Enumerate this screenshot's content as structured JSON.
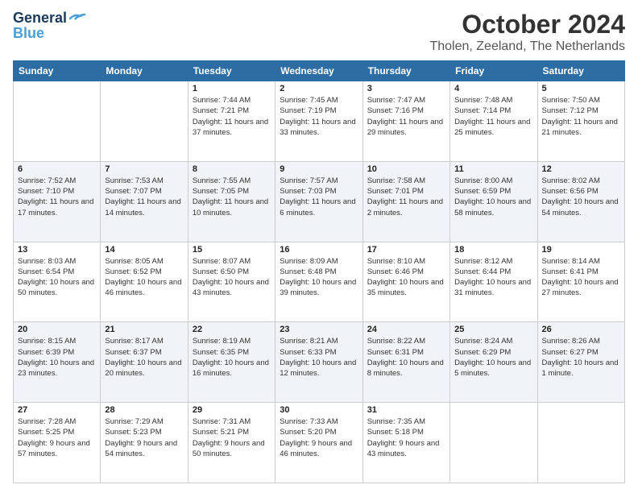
{
  "logo": {
    "line1": "General",
    "line2": "Blue"
  },
  "title": "October 2024",
  "location": "Tholen, Zeeland, The Netherlands",
  "weekdays": [
    "Sunday",
    "Monday",
    "Tuesday",
    "Wednesday",
    "Thursday",
    "Friday",
    "Saturday"
  ],
  "weeks": [
    [
      {
        "day": "",
        "sunrise": "",
        "sunset": "",
        "daylight": ""
      },
      {
        "day": "",
        "sunrise": "",
        "sunset": "",
        "daylight": ""
      },
      {
        "day": "1",
        "sunrise": "Sunrise: 7:44 AM",
        "sunset": "Sunset: 7:21 PM",
        "daylight": "Daylight: 11 hours and 37 minutes."
      },
      {
        "day": "2",
        "sunrise": "Sunrise: 7:45 AM",
        "sunset": "Sunset: 7:19 PM",
        "daylight": "Daylight: 11 hours and 33 minutes."
      },
      {
        "day": "3",
        "sunrise": "Sunrise: 7:47 AM",
        "sunset": "Sunset: 7:16 PM",
        "daylight": "Daylight: 11 hours and 29 minutes."
      },
      {
        "day": "4",
        "sunrise": "Sunrise: 7:48 AM",
        "sunset": "Sunset: 7:14 PM",
        "daylight": "Daylight: 11 hours and 25 minutes."
      },
      {
        "day": "5",
        "sunrise": "Sunrise: 7:50 AM",
        "sunset": "Sunset: 7:12 PM",
        "daylight": "Daylight: 11 hours and 21 minutes."
      }
    ],
    [
      {
        "day": "6",
        "sunrise": "Sunrise: 7:52 AM",
        "sunset": "Sunset: 7:10 PM",
        "daylight": "Daylight: 11 hours and 17 minutes."
      },
      {
        "day": "7",
        "sunrise": "Sunrise: 7:53 AM",
        "sunset": "Sunset: 7:07 PM",
        "daylight": "Daylight: 11 hours and 14 minutes."
      },
      {
        "day": "8",
        "sunrise": "Sunrise: 7:55 AM",
        "sunset": "Sunset: 7:05 PM",
        "daylight": "Daylight: 11 hours and 10 minutes."
      },
      {
        "day": "9",
        "sunrise": "Sunrise: 7:57 AM",
        "sunset": "Sunset: 7:03 PM",
        "daylight": "Daylight: 11 hours and 6 minutes."
      },
      {
        "day": "10",
        "sunrise": "Sunrise: 7:58 AM",
        "sunset": "Sunset: 7:01 PM",
        "daylight": "Daylight: 11 hours and 2 minutes."
      },
      {
        "day": "11",
        "sunrise": "Sunrise: 8:00 AM",
        "sunset": "Sunset: 6:59 PM",
        "daylight": "Daylight: 10 hours and 58 minutes."
      },
      {
        "day": "12",
        "sunrise": "Sunrise: 8:02 AM",
        "sunset": "Sunset: 6:56 PM",
        "daylight": "Daylight: 10 hours and 54 minutes."
      }
    ],
    [
      {
        "day": "13",
        "sunrise": "Sunrise: 8:03 AM",
        "sunset": "Sunset: 6:54 PM",
        "daylight": "Daylight: 10 hours and 50 minutes."
      },
      {
        "day": "14",
        "sunrise": "Sunrise: 8:05 AM",
        "sunset": "Sunset: 6:52 PM",
        "daylight": "Daylight: 10 hours and 46 minutes."
      },
      {
        "day": "15",
        "sunrise": "Sunrise: 8:07 AM",
        "sunset": "Sunset: 6:50 PM",
        "daylight": "Daylight: 10 hours and 43 minutes."
      },
      {
        "day": "16",
        "sunrise": "Sunrise: 8:09 AM",
        "sunset": "Sunset: 6:48 PM",
        "daylight": "Daylight: 10 hours and 39 minutes."
      },
      {
        "day": "17",
        "sunrise": "Sunrise: 8:10 AM",
        "sunset": "Sunset: 6:46 PM",
        "daylight": "Daylight: 10 hours and 35 minutes."
      },
      {
        "day": "18",
        "sunrise": "Sunrise: 8:12 AM",
        "sunset": "Sunset: 6:44 PM",
        "daylight": "Daylight: 10 hours and 31 minutes."
      },
      {
        "day": "19",
        "sunrise": "Sunrise: 8:14 AM",
        "sunset": "Sunset: 6:41 PM",
        "daylight": "Daylight: 10 hours and 27 minutes."
      }
    ],
    [
      {
        "day": "20",
        "sunrise": "Sunrise: 8:15 AM",
        "sunset": "Sunset: 6:39 PM",
        "daylight": "Daylight: 10 hours and 23 minutes."
      },
      {
        "day": "21",
        "sunrise": "Sunrise: 8:17 AM",
        "sunset": "Sunset: 6:37 PM",
        "daylight": "Daylight: 10 hours and 20 minutes."
      },
      {
        "day": "22",
        "sunrise": "Sunrise: 8:19 AM",
        "sunset": "Sunset: 6:35 PM",
        "daylight": "Daylight: 10 hours and 16 minutes."
      },
      {
        "day": "23",
        "sunrise": "Sunrise: 8:21 AM",
        "sunset": "Sunset: 6:33 PM",
        "daylight": "Daylight: 10 hours and 12 minutes."
      },
      {
        "day": "24",
        "sunrise": "Sunrise: 8:22 AM",
        "sunset": "Sunset: 6:31 PM",
        "daylight": "Daylight: 10 hours and 8 minutes."
      },
      {
        "day": "25",
        "sunrise": "Sunrise: 8:24 AM",
        "sunset": "Sunset: 6:29 PM",
        "daylight": "Daylight: 10 hours and 5 minutes."
      },
      {
        "day": "26",
        "sunrise": "Sunrise: 8:26 AM",
        "sunset": "Sunset: 6:27 PM",
        "daylight": "Daylight: 10 hours and 1 minute."
      }
    ],
    [
      {
        "day": "27",
        "sunrise": "Sunrise: 7:28 AM",
        "sunset": "Sunset: 5:25 PM",
        "daylight": "Daylight: 9 hours and 57 minutes."
      },
      {
        "day": "28",
        "sunrise": "Sunrise: 7:29 AM",
        "sunset": "Sunset: 5:23 PM",
        "daylight": "Daylight: 9 hours and 54 minutes."
      },
      {
        "day": "29",
        "sunrise": "Sunrise: 7:31 AM",
        "sunset": "Sunset: 5:21 PM",
        "daylight": "Daylight: 9 hours and 50 minutes."
      },
      {
        "day": "30",
        "sunrise": "Sunrise: 7:33 AM",
        "sunset": "Sunset: 5:20 PM",
        "daylight": "Daylight: 9 hours and 46 minutes."
      },
      {
        "day": "31",
        "sunrise": "Sunrise: 7:35 AM",
        "sunset": "Sunset: 5:18 PM",
        "daylight": "Daylight: 9 hours and 43 minutes."
      },
      {
        "day": "",
        "sunrise": "",
        "sunset": "",
        "daylight": ""
      },
      {
        "day": "",
        "sunrise": "",
        "sunset": "",
        "daylight": ""
      }
    ]
  ]
}
